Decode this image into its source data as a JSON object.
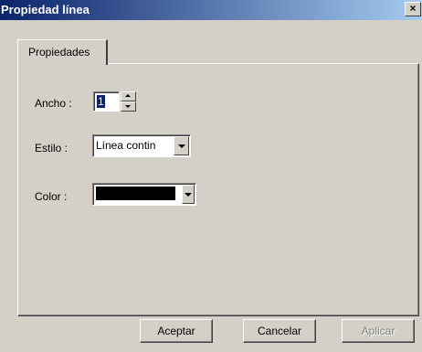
{
  "window": {
    "title": "Propiedad línea",
    "close_glyph": "×"
  },
  "tabs": [
    {
      "label": "Propiedades",
      "selected": true
    }
  ],
  "fields": {
    "width_label": "Ancho :",
    "width_value": "1",
    "style_label": "Estilo :",
    "style_value": "Línea contin",
    "color_label": "Color :",
    "color_value": "#000000"
  },
  "buttons": {
    "accept": "Aceptar",
    "cancel": "Cancelar",
    "apply": "Aplicar",
    "apply_enabled": false
  }
}
